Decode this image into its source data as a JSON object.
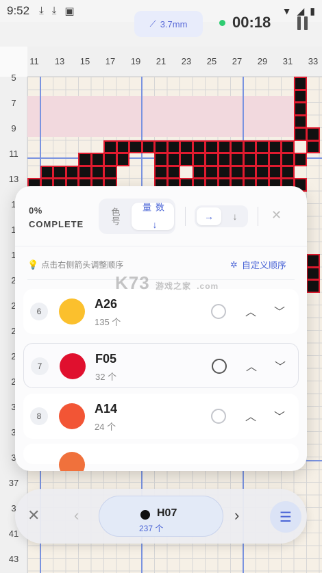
{
  "status_bar": {
    "time": "9:52",
    "icons": [
      "download-icon",
      "download-icon",
      "font-icon"
    ],
    "right_icons": [
      "wifi-icon",
      "signal-icon",
      "battery-icon"
    ]
  },
  "toolbar": {
    "bead_size": "3.7mm",
    "timer": "00:18"
  },
  "grid": {
    "col_labels": [
      "11",
      "13",
      "15",
      "17",
      "19",
      "21",
      "23",
      "25",
      "27",
      "29",
      "31",
      "33"
    ],
    "row_labels": [
      "5",
      "7",
      "9",
      "11",
      "13",
      "1",
      "1",
      "1",
      "2",
      "2",
      "2",
      "2",
      "2",
      "3",
      "3",
      "3",
      "37",
      "3",
      "41",
      "43"
    ]
  },
  "sheet": {
    "progress_pct": "0%",
    "progress_label": "COMPLETE",
    "sort_color": "色号",
    "sort_count": "数量",
    "sort_arrow": "↓",
    "dir_right": "→",
    "dir_down": "↓",
    "close": "✕",
    "hint": "点击右侧箭头调整顺序",
    "custom_order": "自定义顺序",
    "items": [
      {
        "index": "6",
        "code": "A26",
        "count": "135 个",
        "color": "#fbc02d"
      },
      {
        "index": "7",
        "code": "F05",
        "count": "32 个",
        "color": "#e0102e"
      },
      {
        "index": "8",
        "code": "A14",
        "count": "24 个",
        "color": "#f25535"
      }
    ]
  },
  "watermark": {
    "brand": "K73",
    "cn": "游戏之家",
    "domain": ".com"
  },
  "bottom": {
    "close": "✕",
    "prev": "‹",
    "next": "›",
    "current_code": "H07",
    "current_count": "237 个",
    "current_color": "#111111"
  }
}
